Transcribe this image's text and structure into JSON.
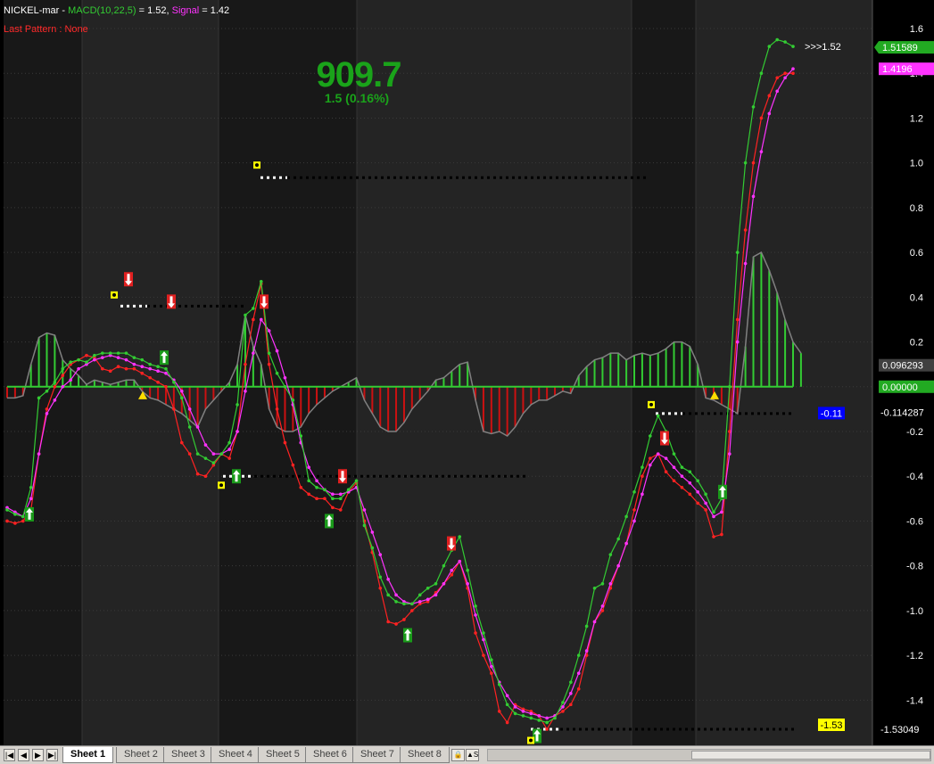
{
  "header": {
    "symbol": "NICKEL-mar",
    "sep": " - ",
    "macd_label": "MACD(10,22,5)",
    "macd_value": " = 1.52, ",
    "signal_label": "Signal",
    "signal_value": "  = 1.42",
    "pattern": "Last Pattern : None"
  },
  "price": {
    "last": "909.7",
    "change": "1.5 (0.16%)"
  },
  "chart_data": {
    "type": "line",
    "title": "",
    "ylim": [
      -1.6,
      1.65
    ],
    "ytick_labels": [
      "1.6",
      "1.4",
      "1.2",
      "1.0",
      "0.8",
      "0.6",
      "0.4",
      "0.2",
      "0",
      "-0.2",
      "-0.4",
      "-0.6",
      "-0.8",
      "-1.0",
      "-1.2",
      "-1.4"
    ],
    "grid": true,
    "series": [
      {
        "name": "MACD(10,22,5)",
        "color": "#33cc33",
        "values": [
          -0.55,
          -0.57,
          -0.58,
          -0.45,
          -0.05,
          -0.02,
          0.02,
          0.08,
          0.11,
          0.12,
          0.11,
          0.14,
          0.15,
          0.15,
          0.15,
          0.15,
          0.13,
          0.12,
          0.1,
          0.09,
          0.08,
          0.02,
          -0.05,
          -0.18,
          -0.3,
          -0.32,
          -0.34,
          -0.3,
          -0.25,
          -0.08,
          0.32,
          0.35,
          0.47,
          0.15,
          0.06,
          0.0,
          -0.06,
          -0.22,
          -0.42,
          -0.45,
          -0.46,
          -0.5,
          -0.5,
          -0.46,
          -0.42,
          -0.62,
          -0.72,
          -0.85,
          -0.93,
          -0.96,
          -0.97,
          -0.97,
          -0.93,
          -0.9,
          -0.88,
          -0.8,
          -0.73,
          -0.67,
          -0.82,
          -0.98,
          -1.1,
          -1.22,
          -1.33,
          -1.42,
          -1.46,
          -1.47,
          -1.48,
          -1.49,
          -1.5,
          -1.48,
          -1.41,
          -1.32,
          -1.2,
          -1.07,
          -0.9,
          -0.88,
          -0.75,
          -0.68,
          -0.58,
          -0.47,
          -0.36,
          -0.22,
          -0.13,
          -0.2,
          -0.3,
          -0.36,
          -0.38,
          -0.42,
          -0.48,
          -0.56,
          -0.5,
          0.0,
          0.6,
          1.0,
          1.25,
          1.4,
          1.52,
          1.55,
          1.54,
          1.52
        ]
      },
      {
        "name": "Signal",
        "color": "#ff33ff",
        "values": [
          -0.54,
          -0.56,
          -0.58,
          -0.5,
          -0.3,
          -0.12,
          -0.06,
          0.0,
          0.03,
          0.08,
          0.1,
          0.12,
          0.13,
          0.14,
          0.13,
          0.12,
          0.1,
          0.09,
          0.08,
          0.07,
          0.06,
          0.03,
          -0.02,
          -0.1,
          -0.18,
          -0.26,
          -0.3,
          -0.3,
          -0.28,
          -0.2,
          -0.02,
          0.15,
          0.3,
          0.25,
          0.16,
          0.04,
          -0.08,
          -0.25,
          -0.36,
          -0.42,
          -0.46,
          -0.48,
          -0.48,
          -0.47,
          -0.45,
          -0.55,
          -0.65,
          -0.75,
          -0.86,
          -0.93,
          -0.96,
          -0.97,
          -0.96,
          -0.95,
          -0.93,
          -0.88,
          -0.82,
          -0.78,
          -0.88,
          -1.02,
          -1.13,
          -1.25,
          -1.32,
          -1.38,
          -1.43,
          -1.45,
          -1.46,
          -1.47,
          -1.48,
          -1.47,
          -1.43,
          -1.37,
          -1.28,
          -1.18,
          -1.05,
          -0.98,
          -0.88,
          -0.8,
          -0.7,
          -0.6,
          -0.48,
          -0.35,
          -0.3,
          -0.32,
          -0.36,
          -0.4,
          -0.43,
          -0.47,
          -0.52,
          -0.58,
          -0.56,
          -0.3,
          0.2,
          0.55,
          0.85,
          1.05,
          1.22,
          1.32,
          1.38,
          1.42
        ]
      },
      {
        "name": "Price (red)",
        "color": "#ff2222",
        "values": [
          -0.6,
          -0.61,
          -0.6,
          -0.55,
          -0.3,
          -0.1,
          0.0,
          0.05,
          0.1,
          0.12,
          0.14,
          0.13,
          0.08,
          0.07,
          0.09,
          0.08,
          0.08,
          0.06,
          0.04,
          0.02,
          0.0,
          -0.1,
          -0.25,
          -0.3,
          -0.39,
          -0.4,
          -0.35,
          -0.3,
          -0.32,
          -0.2,
          0.1,
          0.3,
          0.46,
          0.1,
          -0.1,
          -0.25,
          -0.35,
          -0.45,
          -0.48,
          -0.5,
          -0.5,
          -0.54,
          -0.55,
          -0.47,
          -0.43,
          -0.6,
          -0.74,
          -0.9,
          -1.05,
          -1.06,
          -1.04,
          -1.0,
          -0.97,
          -0.96,
          -0.92,
          -0.88,
          -0.84,
          -0.78,
          -0.9,
          -1.1,
          -1.2,
          -1.28,
          -1.45,
          -1.5,
          -1.42,
          -1.44,
          -1.45,
          -1.47,
          -1.53,
          -1.47,
          -1.45,
          -1.42,
          -1.35,
          -1.2,
          -1.05,
          -1.0,
          -0.9,
          -0.8,
          -0.7,
          -0.55,
          -0.4,
          -0.32,
          -0.3,
          -0.38,
          -0.42,
          -0.45,
          -0.48,
          -0.52,
          -0.55,
          -0.67,
          -0.66,
          -0.2,
          0.3,
          0.7,
          1.0,
          1.2,
          1.3,
          1.38,
          1.4,
          1.4
        ]
      },
      {
        "name": "Histogram",
        "color": "#33cc33",
        "values": [
          -0.05,
          -0.05,
          -0.04,
          0.1,
          0.22,
          0.24,
          0.23,
          0.12,
          0.08,
          0.05,
          0.01,
          0.03,
          0.02,
          0.01,
          0.02,
          0.03,
          0.03,
          -0.02,
          -0.05,
          -0.06,
          -0.08,
          -0.1,
          -0.12,
          -0.15,
          -0.18,
          -0.1,
          -0.06,
          -0.02,
          0.02,
          0.1,
          0.32,
          0.18,
          0.1,
          -0.1,
          -0.18,
          -0.2,
          -0.2,
          -0.18,
          -0.12,
          -0.08,
          -0.05,
          -0.02,
          0.0,
          0.02,
          0.04,
          -0.06,
          -0.12,
          -0.18,
          -0.2,
          -0.2,
          -0.16,
          -0.1,
          -0.06,
          -0.02,
          0.03,
          0.04,
          0.07,
          0.1,
          0.11,
          -0.06,
          -0.2,
          -0.21,
          -0.2,
          -0.22,
          -0.18,
          -0.12,
          -0.08,
          -0.06,
          -0.06,
          -0.04,
          -0.02,
          -0.03,
          0.05,
          0.09,
          0.12,
          0.13,
          0.15,
          0.15,
          0.12,
          0.14,
          0.15,
          0.14,
          0.15,
          0.17,
          0.2,
          0.2,
          0.18,
          0.1,
          -0.05,
          -0.06,
          -0.08,
          -0.1,
          -0.12,
          0.18,
          0.58,
          0.6,
          0.52,
          0.42,
          0.3,
          0.2,
          0.15
        ]
      }
    ],
    "right_axis_markers": [
      {
        "label": ">>>1.52",
        "value": 1.52,
        "style": "text"
      },
      {
        "label": "1.51589",
        "value": 1.516,
        "bg": "#22aa22",
        "fg": "#ffffff"
      },
      {
        "label": "1.4196",
        "value": 1.42,
        "bg": "#ff33ff",
        "fg": "#ffffff"
      },
      {
        "label": "0.096293",
        "value": 0.096,
        "bg": "#404040",
        "fg": "#ffffff"
      },
      {
        "label": "0.00000",
        "value": 0.0,
        "bg": "#22aa22",
        "fg": "#ffffff"
      },
      {
        "label": "-0.114287",
        "value": -0.114,
        "style": "text"
      },
      {
        "label": "-1.53049",
        "value": -1.53,
        "style": "text"
      }
    ],
    "level_tags": [
      {
        "label": "-0.11",
        "value": -0.11,
        "bg": "#0000ff",
        "fg": "#ffffff"
      },
      {
        "label": "-1.53",
        "value": -1.53,
        "bg": "#ffff00",
        "fg": "#000000"
      }
    ]
  },
  "tabs": {
    "active": "Sheet 1",
    "items": [
      "Sheet 1",
      "Sheet 2",
      "Sheet 3",
      "Sheet 4",
      "Sheet 5",
      "Sheet 6",
      "Sheet 7",
      "Sheet 8"
    ],
    "nav": [
      "|◀",
      "◀",
      "▶",
      "▶|"
    ]
  },
  "colors": {
    "background": "#000000",
    "band_dark": "#181818",
    "band_light": "#242424",
    "grid": "#3a3a3a",
    "zero_line": "#33cc33",
    "hist_pos": "#33cc33",
    "hist_neg": "#cc1111",
    "hist_outline": "#808080"
  }
}
